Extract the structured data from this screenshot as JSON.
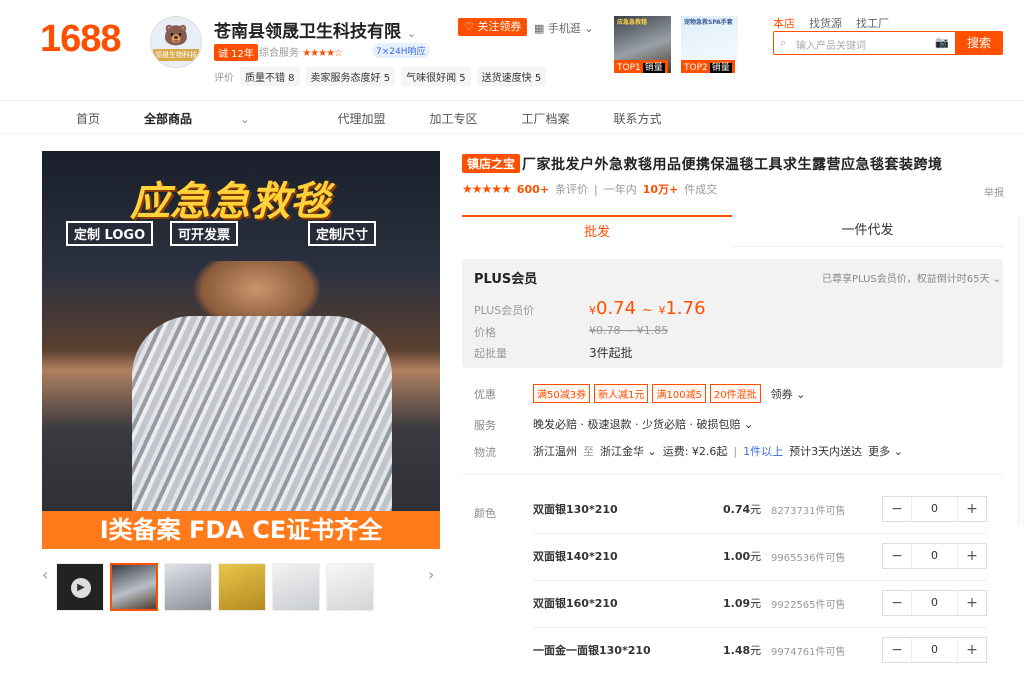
{
  "brand": {
    "logo": "1688"
  },
  "shop": {
    "name": "苍南县领晟卫生科技有限",
    "years_badge": "诚 12年",
    "rating_label": "综合服务",
    "stars": "★★★★☆",
    "service_badge": "7×24H响应",
    "follow_button": "关注领券",
    "mobile_link": "手机逛",
    "evals_label": "评价",
    "evals": [
      "质量不错 8",
      "卖家服务态度好 5",
      "气味很好闻 5",
      "送货速度快 5"
    ],
    "avatar_text": "领晟生物科技"
  },
  "top_products": [
    {
      "title": "应急急救毯",
      "tag": "TOP1",
      "tag_rest": "销量"
    },
    {
      "title": "宠物急救SPA手套",
      "tag": "TOP2",
      "tag_rest": "销量"
    }
  ],
  "search": {
    "scopes": [
      "本店",
      "找货源",
      "找工厂"
    ],
    "placeholder": "输入产品关键词",
    "button": "搜索"
  },
  "nav": {
    "items": [
      "首页",
      "全部商品",
      "代理加盟",
      "加工专区",
      "工厂档案",
      "联系方式"
    ]
  },
  "main_image": {
    "headline": "应急急救毯",
    "features": [
      "定制 LOGO",
      "可开发票",
      "定制尺寸"
    ],
    "banner": "I类备案 FDA CE证书齐全"
  },
  "product": {
    "badge": "镇店之宝",
    "title": "厂家批发户外急救毯用品便携保温毯工具求生露营应急毯套装跨境",
    "eval_count": "600+",
    "eval_label": "条评价",
    "period": "一年内",
    "sold": "10万+",
    "sold_label": "件成交",
    "report": "举报"
  },
  "tabs": {
    "wholesale": "批发",
    "dropship": "一件代发"
  },
  "plus": {
    "title": "PLUS会员",
    "note": "已尊享PLUS会员价，权益倒计时65天",
    "price_label": "PLUS会员价",
    "yen": "¥",
    "price_low": "0.74",
    "tilde": "~",
    "price_high": "1.76",
    "orig_label": "价格",
    "orig_price": "¥0.78 ~ ¥1.85",
    "min_label": "起批量",
    "min_value": "3件起批"
  },
  "promo": {
    "label": "优惠",
    "coupons": [
      "满50减3券",
      "新人减1元",
      "满100减5",
      "20件混批"
    ],
    "more": "领券"
  },
  "service": {
    "label": "服务",
    "text": "晚发必赔 · 极速退款 · 少货必赔 · 破损包赔"
  },
  "logistics": {
    "label": "物流",
    "from": "浙江温州",
    "to_word": "至",
    "to": "浙江金华",
    "fee": "运费: ¥2.6起",
    "qty": "1件以上",
    "eta": "预计3天内送达",
    "more": "更多"
  },
  "sku": {
    "color_label": "颜色",
    "unit": "元",
    "rows": [
      {
        "name": "双面银130*210",
        "price": "0.74",
        "stock": "8273731件可售",
        "qty": "0"
      },
      {
        "name": "双面银140*210",
        "price": "1.00",
        "stock": "9965536件可售",
        "qty": "0"
      },
      {
        "name": "双面银160*210",
        "price": "1.09",
        "stock": "9922565件可售",
        "qty": "0"
      },
      {
        "name": "一面金一面银130*210",
        "price": "1.48",
        "stock": "9974761件可售",
        "qty": "0"
      }
    ]
  },
  "colors": {
    "accent": "#ff5000",
    "link": "#3c6de0"
  }
}
